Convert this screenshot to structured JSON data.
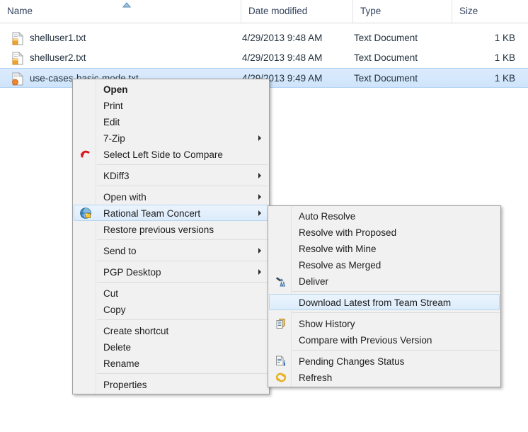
{
  "explorer": {
    "columns": [
      {
        "label": "Name",
        "key": "name"
      },
      {
        "label": "Date modified",
        "key": "date"
      },
      {
        "label": "Type",
        "key": "type"
      },
      {
        "label": "Size",
        "key": "size"
      }
    ],
    "sort": {
      "column": "Name",
      "direction": "ascending",
      "indicator_icon": "sort-ascending-icon"
    },
    "rows": [
      {
        "icon": "text-document-icon",
        "name": "shelluser1.txt",
        "date": "4/29/2013 9:48 AM",
        "type": "Text Document",
        "size": "1 KB",
        "selected": false
      },
      {
        "icon": "text-document-icon",
        "name": "shelluser2.txt",
        "date": "4/29/2013 9:48 AM",
        "type": "Text Document",
        "size": "1 KB",
        "selected": false
      },
      {
        "icon": "text-document-icon",
        "name": "use-cases-basic-mode.txt",
        "date": "4/29/2013 9:49 AM",
        "type": "Text Document",
        "size": "1 KB",
        "selected": true
      }
    ]
  },
  "context_menu": {
    "items": [
      {
        "label": "Open",
        "bold": true,
        "submenu": false,
        "icon": null,
        "separator_after": false
      },
      {
        "label": "Print",
        "bold": false,
        "submenu": false,
        "icon": null,
        "separator_after": false
      },
      {
        "label": "Edit",
        "bold": false,
        "submenu": false,
        "icon": null,
        "separator_after": false
      },
      {
        "label": "7-Zip",
        "bold": false,
        "submenu": true,
        "icon": null,
        "separator_after": false
      },
      {
        "label": "Select Left Side to Compare",
        "bold": false,
        "submenu": false,
        "icon": "undo-arrow-icon",
        "separator_after": true
      },
      {
        "label": "KDiff3",
        "bold": false,
        "submenu": true,
        "icon": null,
        "separator_after": true
      },
      {
        "label": "Open with",
        "bold": false,
        "submenu": true,
        "icon": null,
        "separator_after": false
      },
      {
        "label": "Rational Team Concert",
        "bold": false,
        "submenu": true,
        "icon": "rtc-globe-icon",
        "highlighted": true,
        "separator_after": false
      },
      {
        "label": "Restore previous versions",
        "bold": false,
        "submenu": false,
        "icon": null,
        "separator_after": true
      },
      {
        "label": "Send to",
        "bold": false,
        "submenu": true,
        "icon": null,
        "separator_after": true
      },
      {
        "label": "PGP Desktop",
        "bold": false,
        "submenu": true,
        "icon": null,
        "separator_after": true
      },
      {
        "label": "Cut",
        "bold": false,
        "submenu": false,
        "icon": null,
        "separator_after": false
      },
      {
        "label": "Copy",
        "bold": false,
        "submenu": false,
        "icon": null,
        "separator_after": true
      },
      {
        "label": "Create shortcut",
        "bold": false,
        "submenu": false,
        "icon": null,
        "separator_after": false
      },
      {
        "label": "Delete",
        "bold": false,
        "submenu": false,
        "icon": null,
        "separator_after": false
      },
      {
        "label": "Rename",
        "bold": false,
        "submenu": false,
        "icon": null,
        "separator_after": true
      },
      {
        "label": "Properties",
        "bold": false,
        "submenu": false,
        "icon": null,
        "separator_after": false
      }
    ]
  },
  "submenu": {
    "title": "Rational Team Concert",
    "items": [
      {
        "label": "Auto Resolve",
        "icon": null,
        "separator_after": false
      },
      {
        "label": "Resolve with Proposed",
        "icon": null,
        "separator_after": false
      },
      {
        "label": "Resolve with Mine",
        "icon": null,
        "separator_after": false
      },
      {
        "label": "Resolve as Merged",
        "icon": null,
        "separator_after": false
      },
      {
        "label": "Deliver",
        "icon": "deliver-icon",
        "separator_after": true
      },
      {
        "label": "Download Latest from Team Stream",
        "icon": null,
        "highlighted": true,
        "separator_after": true
      },
      {
        "label": "Show History",
        "icon": "show-history-icon",
        "separator_after": false
      },
      {
        "label": "Compare with Previous Version",
        "icon": null,
        "separator_after": true
      },
      {
        "label": "Pending Changes Status",
        "icon": "pending-changes-icon",
        "separator_after": false
      },
      {
        "label": "Refresh",
        "icon": "refresh-icon",
        "separator_after": false
      }
    ]
  },
  "colors": {
    "menu_background": "#f1f1f1",
    "menu_border": "#a0a0a0",
    "selection_blue": "#cfe4fb",
    "selection_border": "#b2d4f5",
    "header_text": "#33445c",
    "highlight_border": "#b8d6f0"
  }
}
